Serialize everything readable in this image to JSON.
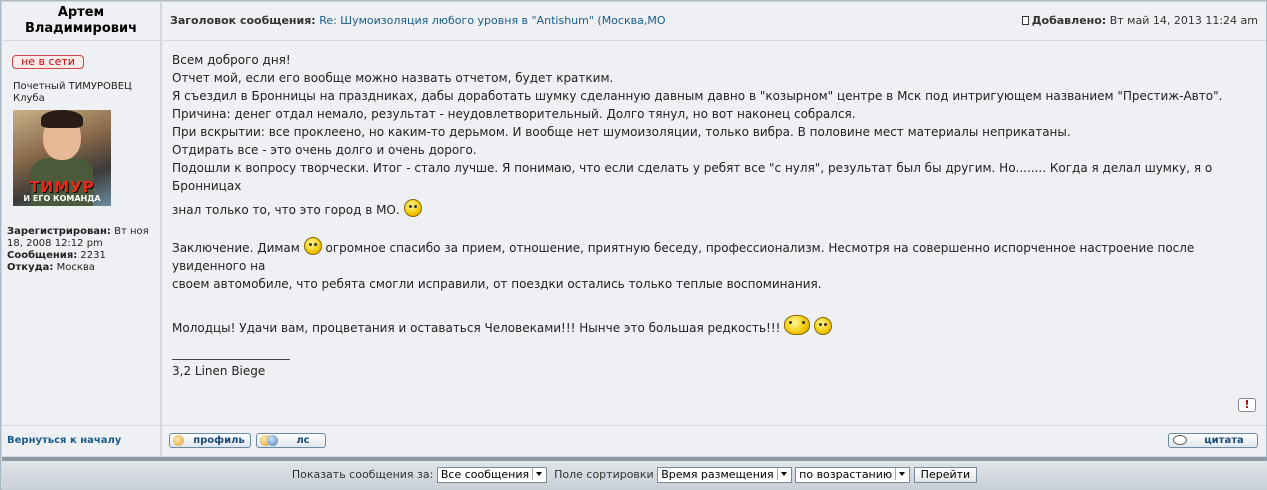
{
  "author": {
    "name": "Артем Владимирович",
    "status": "не в сети",
    "rank": "Почетный ТИМУРОВЕЦ Клуба",
    "avatar_title": "ТИМУР",
    "avatar_sub": "И ЕГО КОМАНДА",
    "registered_label": "Зарегистрирован:",
    "registered_value": "Вт ноя 18, 2008 12:12 pm",
    "posts_label": "Сообщения:",
    "posts_value": "2231",
    "from_label": "Откуда:",
    "from_value": "Москва"
  },
  "post": {
    "subject_label": "Заголовок сообщения:",
    "subject": "Re: Шумоизоляция любого уровня в \"Antishum\" (Москва,МО",
    "added_label": "Добавлено:",
    "added_value": "Вт май 14, 2013 11:24 am",
    "lines": [
      "Всем доброго дня!",
      "Отчет мой, если его вообще можно назвать отчетом, будет кратким.",
      "Я съездил в Бронницы на праздниках, дабы доработать шумку сделанную давным давно в \"козырном\" центре в Мск под интригующем названием \"Престиж-Авто\".",
      "Причина: денег отдал немало, результат - неудовлетворительный. Долго тянул, но вот наконец собрался.",
      "При вскрытии: все проклеено, но каким-то дерьмом. И вообще нет шумоизоляции, только вибра. В половине мест материалы неприкатаны.",
      "Отдирать все - это очень долго и очень дорого.",
      "Подошли к вопросу творчески. Итог - стало лучше. Я понимаю, что если сделать у ребят все \"с нуля\", результат был бы другим. Но........ Когда я делал шумку, я о Бронницах"
    ],
    "line_cont": "знал только то, что это город в МО.",
    "conclusion_a": "Заключение. Димам",
    "conclusion_b": "огромное спасибо за прием, отношение, приятную беседу, профессионализм. Несмотря на совершенно испорченное настроение после увиденного на",
    "conclusion_c": "своем автомобиле, что ребята смогли исправили, от поездки остались только теплые воспоминания.",
    "final": "Молодцы! Удачи вам, процветания и оставаться Человеками!!! Нынче это большая редкость!!!",
    "signature": "3,2 Linen Biege"
  },
  "footer": {
    "back_to_top": "Вернуться к началу",
    "profile": "профиль",
    "pm": "лс",
    "quote": "цитата",
    "report": "!"
  },
  "bottom_bar": {
    "show_label": "Показать сообщения за:",
    "show_value": "Все сообщения",
    "sort_label": "Поле сортировки",
    "sort_value": "Время размещения",
    "order_value": "по возрастанию",
    "go": "Перейти"
  }
}
